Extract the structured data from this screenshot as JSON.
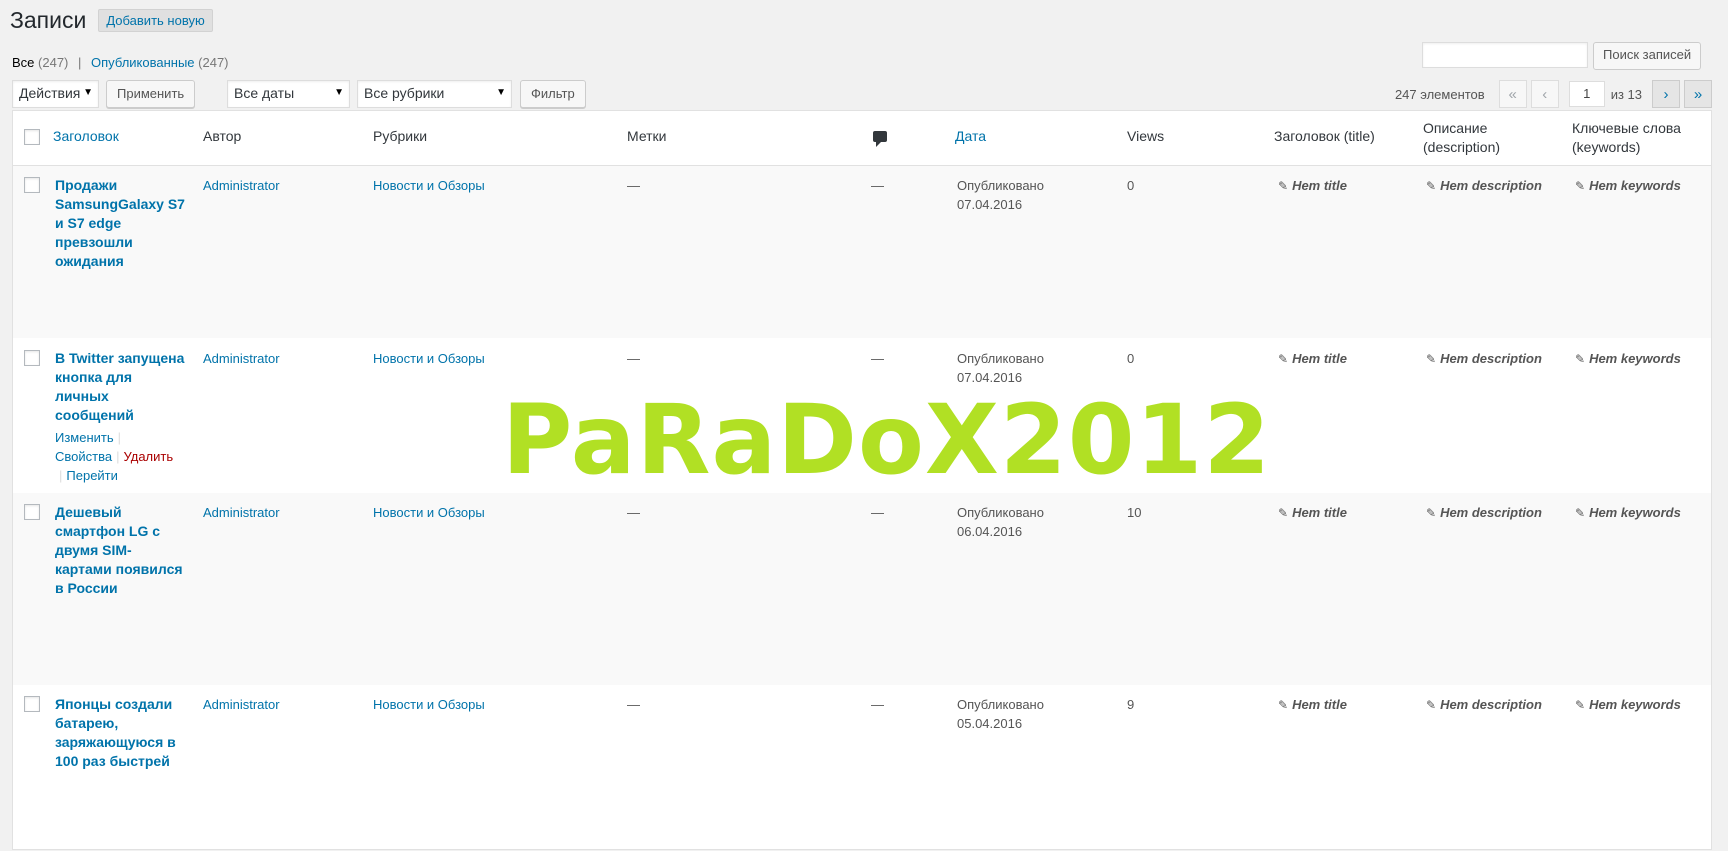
{
  "header": {
    "title": "Записи",
    "add_new": "Добавить новую"
  },
  "views": {
    "all_label": "Все",
    "all_count": "(247)",
    "sep": "|",
    "published_label": "Опубликованные",
    "published_count": "(247)"
  },
  "search": {
    "value": "",
    "button": "Поиск записей"
  },
  "tablenav": {
    "bulk_action": "Действия",
    "apply": "Применить",
    "dates": "Все даты",
    "categories": "Все рубрики",
    "filter": "Фильтр",
    "items_count": "247 элементов",
    "first": "«",
    "prev": "‹",
    "current_page": "1",
    "of": "из 13",
    "next": "›",
    "last": "»"
  },
  "columns": {
    "title": "Заголовок",
    "author": "Автор",
    "categories": "Рубрики",
    "tags": "Метки",
    "date": "Дата",
    "views": "Views",
    "seo_title": "Заголовок (title)",
    "description": "Описание (description)",
    "keywords": "Ключевые слова (keywords)"
  },
  "rows": [
    {
      "title": "Продажи SamsungGalaxy S7 и S7 edge превзошли ожидания",
      "author": "Administrator",
      "category": "Новости и Обзоры",
      "tags": "—",
      "comments": "—",
      "date": "Опубликовано 07.04.2016",
      "views": "0",
      "seo_title": "Нет title",
      "description": "Нет description",
      "keywords": "Нет keywords"
    },
    {
      "title": "В Twitter запущена кнопка для личных сообщений",
      "author": "Administrator",
      "category": "Новости и Обзоры",
      "tags": "—",
      "comments": "—",
      "date": "Опубликовано 07.04.2016",
      "views": "0",
      "seo_title": "Нет title",
      "description": "Нет description",
      "keywords": "Нет keywords",
      "actions": {
        "edit": "Изменить",
        "props": "Свойства",
        "delete": "Удалить",
        "view": "Перейти"
      }
    },
    {
      "title": "Дешевый смартфон LG с двумя SIM-картами появился в России",
      "author": "Administrator",
      "category": "Новости и Обзоры",
      "tags": "—",
      "comments": "—",
      "date": "Опубликовано 06.04.2016",
      "views": "10",
      "seo_title": "Нет title",
      "description": "Нет description",
      "keywords": "Нет keywords"
    },
    {
      "title": "Японцы создали батарею, заряжающуюся в 100 раз быстрей",
      "author": "Administrator",
      "category": "Новости и Обзоры",
      "tags": "—",
      "comments": "—",
      "date": "Опубликовано 05.04.2016",
      "views": "9",
      "seo_title": "Нет title",
      "description": "Нет description",
      "keywords": "Нет keywords"
    }
  ],
  "watermark": "PaRaDoX2012",
  "icons": {
    "comments": "comment-bubble-icon",
    "edit": "pencil-icon"
  },
  "colors": {
    "link": "#0073aa",
    "delete": "#aa0000",
    "watermark": "#b1e024"
  }
}
